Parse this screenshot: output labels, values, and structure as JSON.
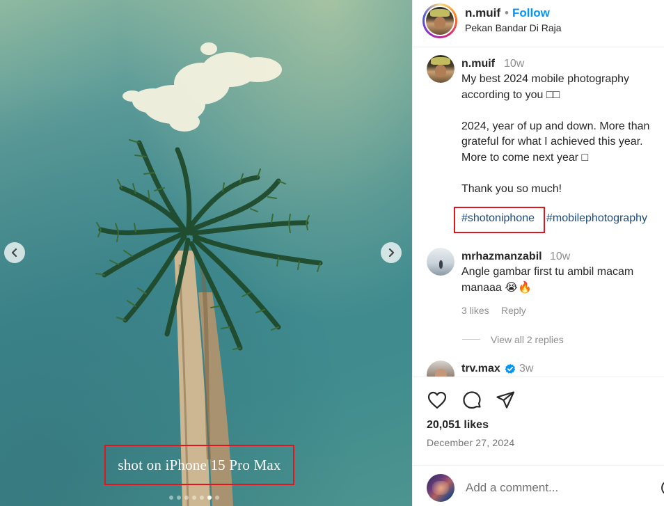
{
  "post": {
    "username": "n.muif",
    "follow_label": "Follow",
    "separator": "•",
    "location": "Pekan Bandar Di Raja",
    "image_caption_text": "shot on iPhone 15 Pro Max",
    "carousel": {
      "count": 7,
      "active_index": 5
    }
  },
  "caption": {
    "username": "n.muif",
    "time": "10w",
    "lines": [
      "My best 2024 mobile photography",
      "according to you □□",
      "",
      "2024, year of up and down. More than",
      "grateful for what I achieved this year.",
      "More to come next year □",
      "",
      "Thank you so much!"
    ],
    "hashtags": [
      "#shotoniphone",
      "#mobilephotography"
    ]
  },
  "comments": [
    {
      "username": "mrhazmanzabil",
      "time": "10w",
      "lines": [
        "Angle gambar first tu ambil macam",
        "manaaa 😭🔥"
      ],
      "likes": "3 likes",
      "reply_label": "Reply",
      "view_replies": "View all 2 replies"
    },
    {
      "username": "trv.max",
      "time": "3w",
      "verified": true
    }
  ],
  "actions": {
    "icons": [
      "heart-icon",
      "comment-icon",
      "share-icon"
    ],
    "likes": "20,051 likes",
    "date": "December 27, 2024"
  },
  "add_comment": {
    "placeholder": "Add a comment..."
  },
  "colors": {
    "follow": "#0095f6",
    "highlight_box": "#e0161c",
    "hashtag": "#1c4a7a",
    "verified": "#0095f6"
  }
}
